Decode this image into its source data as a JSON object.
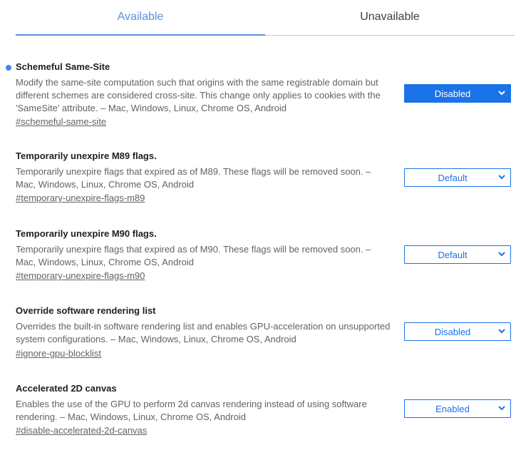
{
  "tabs": [
    {
      "label": "Available"
    },
    {
      "label": "Unavailable"
    }
  ],
  "flags": [
    {
      "title": "Schemeful Same-Site",
      "description": "Modify the same-site computation such that origins with the same registrable domain but different schemes are considered cross-site. This change only applies to cookies with the 'SameSite' attribute. – Mac, Windows, Linux, Chrome OS, Android",
      "link": "#schemeful-same-site",
      "value": "Disabled",
      "modified": true
    },
    {
      "title": "Temporarily unexpire M89 flags.",
      "description": "Temporarily unexpire flags that expired as of M89. These flags will be removed soon. – Mac, Windows, Linux, Chrome OS, Android",
      "link": "#temporary-unexpire-flags-m89",
      "value": "Default"
    },
    {
      "title": "Temporarily unexpire M90 flags.",
      "description": "Temporarily unexpire flags that expired as of M90. These flags will be removed soon. – Mac, Windows, Linux, Chrome OS, Android",
      "link": "#temporary-unexpire-flags-m90",
      "value": "Default"
    },
    {
      "title": "Override software rendering list",
      "description": "Overrides the built-in software rendering list and enables GPU-acceleration on unsupported system configurations. – Mac, Windows, Linux, Chrome OS, Android",
      "link": "#ignore-gpu-blocklist",
      "value": "Disabled"
    },
    {
      "title": "Accelerated 2D canvas",
      "description": "Enables the use of the GPU to perform 2d canvas rendering instead of using software rendering. – Mac, Windows, Linux, Chrome OS, Android",
      "link": "#disable-accelerated-2d-canvas",
      "value": "Enabled"
    }
  ],
  "colors": {
    "accent": "#1a73e8",
    "active_tab": "#5b8fd8",
    "modified_dot": "#4285f4"
  },
  "icons": {
    "dropdown": "chevron-down-icon",
    "modified": "modified-dot"
  }
}
